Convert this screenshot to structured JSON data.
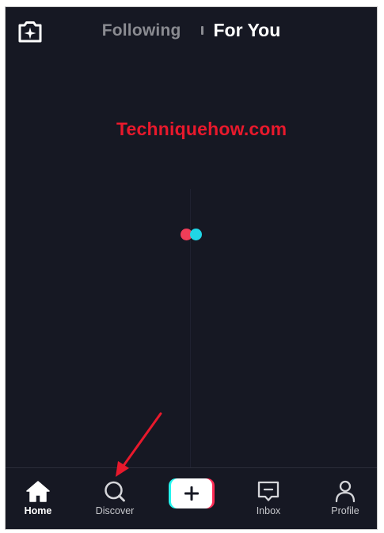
{
  "top_bar": {
    "camera_icon": "camera-sparkle-icon",
    "tabs": [
      {
        "label": "Following",
        "active": false
      },
      {
        "label": "For You",
        "active": true
      }
    ]
  },
  "content": {
    "watermark": "Techniquehow.com",
    "loader_colors": [
      "#ee3d58",
      "#20d5e6"
    ]
  },
  "bottom_nav": {
    "items": [
      {
        "label": "Home",
        "icon": "home-icon",
        "active": true
      },
      {
        "label": "Discover",
        "icon": "search-icon",
        "active": false
      },
      {
        "label": "",
        "icon": "plus-icon",
        "active": false
      },
      {
        "label": "Inbox",
        "icon": "message-icon",
        "active": false
      },
      {
        "label": "Profile",
        "icon": "person-icon",
        "active": false
      }
    ]
  },
  "annotation": {
    "arrow_color": "#e8192c"
  },
  "colors": {
    "background": "#161823",
    "accent_red": "#fe2c55",
    "accent_cyan": "#25f4ee"
  }
}
